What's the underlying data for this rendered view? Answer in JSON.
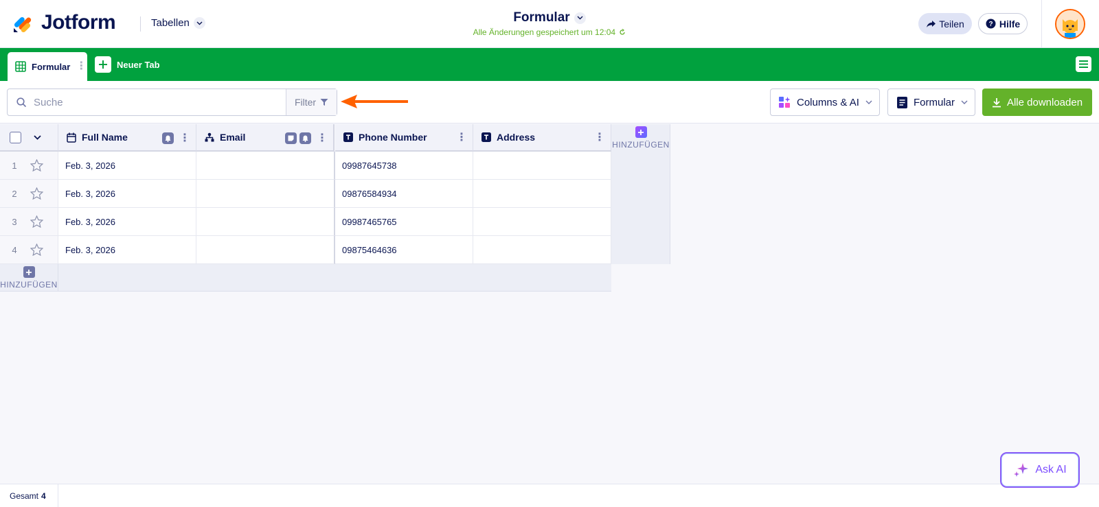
{
  "header": {
    "logo_text": "Jotform",
    "tabellen_label": "Tabellen",
    "form_title": "Formular",
    "saved_status": "Alle Änderungen gespeichert um 12:04",
    "share_label": "Teilen",
    "help_label": "Hilfe"
  },
  "tabs": {
    "active_label": "Formular",
    "new_tab_label": "Neuer Tab"
  },
  "toolbar": {
    "search_placeholder": "Suche",
    "filter_label": "Filter",
    "columns_ai_label": "Columns & AI",
    "view_label": "Formular",
    "download_label": "Alle downloaden"
  },
  "table": {
    "columns": [
      {
        "label": "Full Name",
        "icon": "calendar-icon"
      },
      {
        "label": "Email",
        "icon": "hierarchy-icon"
      },
      {
        "label": "Phone Number",
        "icon": "text-icon"
      },
      {
        "label": "Address",
        "icon": "text-icon"
      }
    ],
    "rows": [
      {
        "num": "1",
        "full_name": "Feb. 3, 2026",
        "email": "",
        "phone": "09987645738",
        "address": ""
      },
      {
        "num": "2",
        "full_name": "Feb. 3, 2026",
        "email": "",
        "phone": "09876584934",
        "address": ""
      },
      {
        "num": "3",
        "full_name": "Feb. 3, 2026",
        "email": "",
        "phone": "09987465765",
        "address": ""
      },
      {
        "num": "4",
        "full_name": "Feb. 3, 2026",
        "email": "",
        "phone": "09875464636",
        "address": ""
      }
    ],
    "add_column_label": "HINZUFÜGEN",
    "add_row_label": "HINZUFÜGEN"
  },
  "footer": {
    "total_label": "Gesamt",
    "total_count": "4"
  },
  "ask_ai_label": "Ask AI",
  "colors": {
    "brand_green": "#01a13e",
    "download_green": "#64b22a",
    "navy": "#0a1551",
    "annotation_arrow": "#ff6100"
  }
}
